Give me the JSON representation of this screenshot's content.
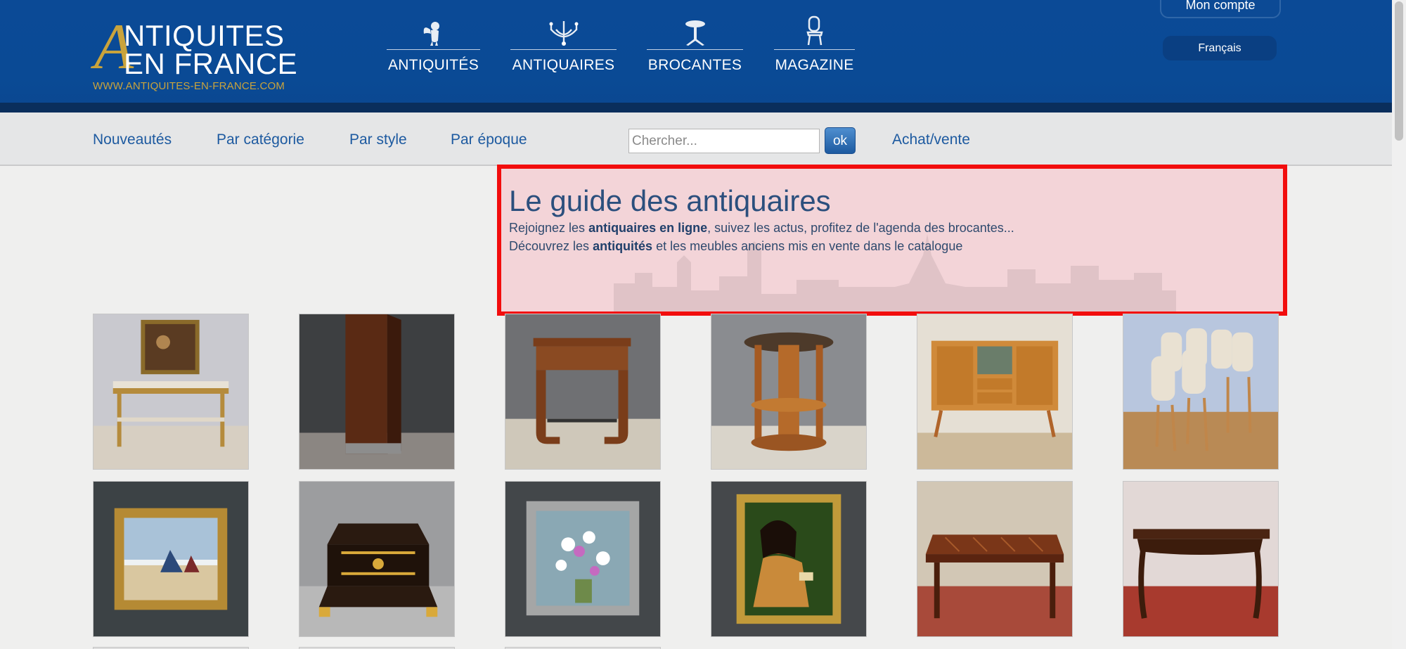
{
  "header": {
    "logo": {
      "initial": "A",
      "line1": "NTIQUITES",
      "line2": "EN FRANCE",
      "url": "WWW.ANTIQUITES-EN-FRANCE.COM"
    },
    "nav": [
      {
        "label": "ANTIQUITÉS",
        "icon": "cherub-icon"
      },
      {
        "label": "ANTIQUAIRES",
        "icon": "chandelier-icon"
      },
      {
        "label": "BROCANTES",
        "icon": "pedestal-table-icon"
      },
      {
        "label": "MAGAZINE",
        "icon": "chair-icon"
      }
    ],
    "account_label": "Mon compte",
    "language_label": "Français"
  },
  "subnav": {
    "links": [
      "Nouveautés",
      "Par catégorie",
      "Par style",
      "Par époque"
    ],
    "search_placeholder": "Chercher...",
    "search_button": "ok",
    "sell_link": "Achat/vente"
  },
  "hero": {
    "title": "Le guide des antiquaires",
    "line1_prefix": "Rejoignez les ",
    "line1_bold": "antiquaires en ligne",
    "line1_suffix": ", suivez les actus, profitez de l'agenda des brocantes...",
    "line2_prefix": "Découvrez les ",
    "line2_bold": "antiquités",
    "line2_suffix": " et les meubles anciens mis en vente dans le catalogue"
  },
  "products": [
    {
      "name": "gilded-console-with-painting"
    },
    {
      "name": "art-deco-column-cabinet"
    },
    {
      "name": "art-deco-side-table"
    },
    {
      "name": "round-pedestal-table"
    },
    {
      "name": "blond-wood-sideboard"
    },
    {
      "name": "set-of-dining-chairs"
    },
    {
      "name": "seaside-painting-gilt-frame"
    },
    {
      "name": "boulle-marquetry-box"
    },
    {
      "name": "flower-bouquet-painting"
    },
    {
      "name": "portrait-painting-woman"
    },
    {
      "name": "parquetry-top-table"
    },
    {
      "name": "louis-xv-style-table"
    }
  ],
  "colors": {
    "header_blue": "#0b4a96",
    "gold": "#c9a33c",
    "link_blue": "#1d5aa0",
    "highlight_red": "#f20d0d"
  }
}
